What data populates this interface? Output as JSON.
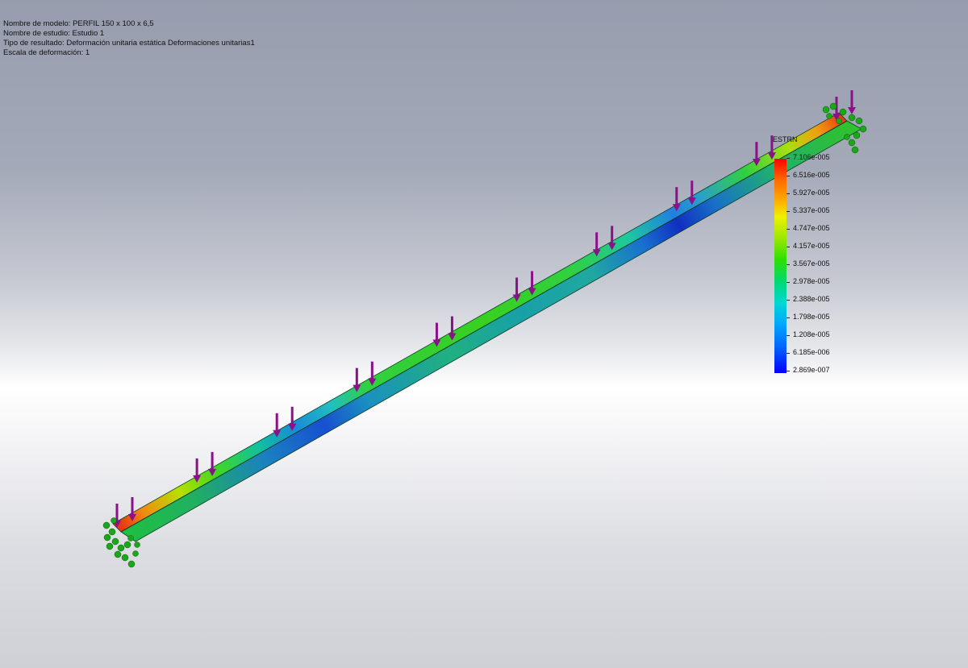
{
  "info": {
    "model_name": "Nombre de modelo: PERFIL 150 x 100 x 6,5",
    "study_name": "Nombre de estudio: Estudio 1",
    "result_type": "Tipo de resultado: Deformación unitaria estática Deformaciones unitarias1",
    "deform_scale": "Escala de deformación: 1"
  },
  "legend": {
    "title": "ESTRN",
    "values": [
      "7.106e-005",
      "6.516e-005",
      "5.927e-005",
      "5.337e-005",
      "4.747e-005",
      "4.157e-005",
      "3.567e-005",
      "2.978e-005",
      "2.388e-005",
      "1.798e-005",
      "1.208e-005",
      "6.185e-006",
      "2.869e-007"
    ],
    "colors": {
      "max": "#ff0000",
      "high": "#ff8000",
      "mid_high": "#f0f000",
      "mid": "#22dd00",
      "mid_low": "#00d8d0",
      "low": "#0064ff",
      "min": "#0000ff"
    }
  },
  "scene": {
    "load_arrow_color": "#8a1188",
    "fixture_color": "#1aa81a",
    "load_count": 20,
    "icons": [
      "load-arrow-icon",
      "fixed-support-icon"
    ]
  }
}
